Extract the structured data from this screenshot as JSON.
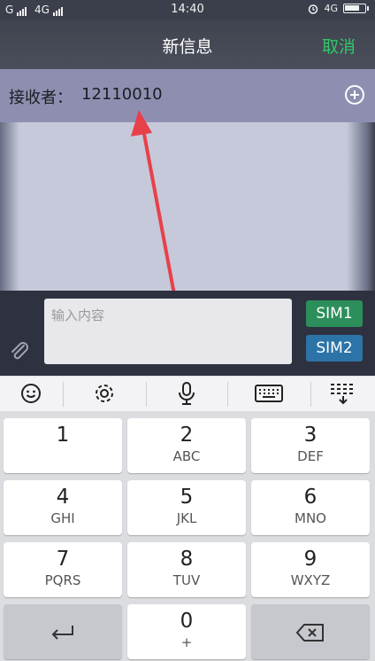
{
  "status": {
    "carrier1": "G",
    "carrier2": "4G",
    "time": "14:40",
    "network": "4G"
  },
  "header": {
    "title": "新信息",
    "cancel": "取消"
  },
  "recipient": {
    "label": "接收者：",
    "value": "12110010"
  },
  "compose": {
    "placeholder": "输入内容",
    "sim1": "SIM1",
    "sim2": "SIM2"
  },
  "toolbar": {
    "icons": [
      "emoji-icon",
      "gear-icon",
      "mic-icon",
      "keyboard-icon",
      "collapse-keyboard-icon"
    ]
  },
  "keypad": {
    "keys": [
      {
        "num": "1",
        "letters": ""
      },
      {
        "num": "2",
        "letters": "ABC"
      },
      {
        "num": "3",
        "letters": "DEF"
      },
      {
        "num": "4",
        "letters": "GHI"
      },
      {
        "num": "5",
        "letters": "JKL"
      },
      {
        "num": "6",
        "letters": "MNO"
      },
      {
        "num": "7",
        "letters": "PQRS"
      },
      {
        "num": "8",
        "letters": "TUV"
      },
      {
        "num": "9",
        "letters": "WXYZ"
      },
      {
        "num": "0",
        "letters": "+"
      }
    ]
  },
  "colors": {
    "accent_green": "#2fc86a",
    "sim1": "#2c8f5b",
    "sim2": "#2c74a8",
    "recipient_bg": "#8e8fb0",
    "arrow": "#e8404a"
  }
}
